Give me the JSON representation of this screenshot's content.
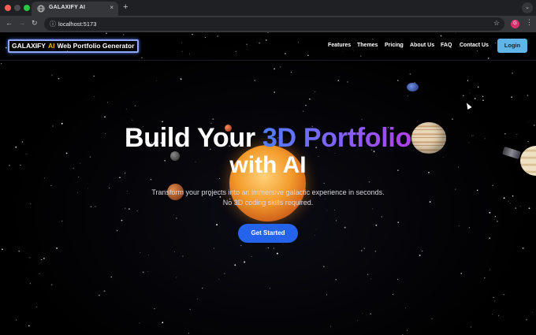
{
  "browser": {
    "tab_title": "GALAXIFY AI",
    "tab_close": "×",
    "new_tab": "+",
    "url": "localhost:5173",
    "profile_initial": "G"
  },
  "header": {
    "logo_brand": "GALAXIFY",
    "logo_ai": "AI",
    "logo_rest": "Web Portfolio Generator",
    "nav": [
      "Features",
      "Themes",
      "Pricing",
      "About Us",
      "FAQ",
      "Contact Us"
    ],
    "login_label": "Login"
  },
  "hero": {
    "title_part1": "Build Your ",
    "title_highlight": "3D Portfolio",
    "title_line2": "with AI",
    "subtitle_line1": "Transform your projects into an immersive galactic experience in seconds.",
    "subtitle_line2": "No 3D coding skills required.",
    "cta_label": "Get Started"
  },
  "colors": {
    "accent": "#2563eb",
    "login_bg": "#5fb4e8",
    "logo_ai": "#f5b301",
    "gradient_start": "#4f7dff",
    "gradient_end": "#b040e8"
  }
}
